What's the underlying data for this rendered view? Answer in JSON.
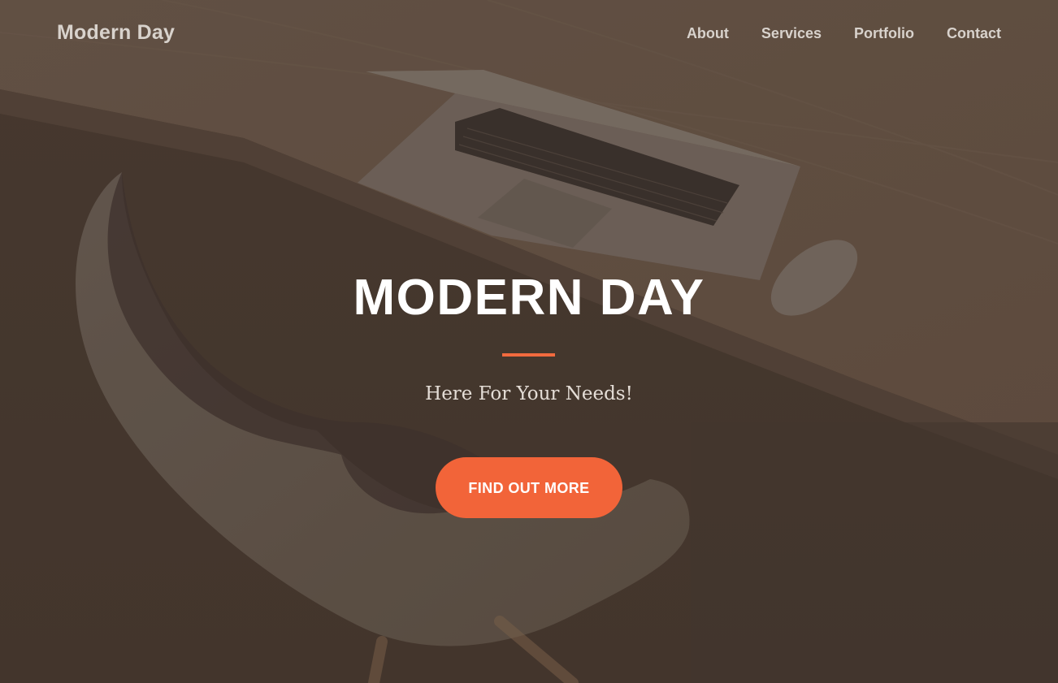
{
  "brand": {
    "name": "Modern Day"
  },
  "nav": {
    "items": [
      {
        "label": "About"
      },
      {
        "label": "Services"
      },
      {
        "label": "Portfolio"
      },
      {
        "label": "Contact"
      }
    ]
  },
  "hero": {
    "headline": "MODERN DAY",
    "tagline": "Here For Your Needs!",
    "cta_label": "FIND OUT MORE"
  },
  "colors": {
    "accent": "#f26439",
    "nav_text": "#d8d2cc",
    "overlay": "#4e4036"
  }
}
